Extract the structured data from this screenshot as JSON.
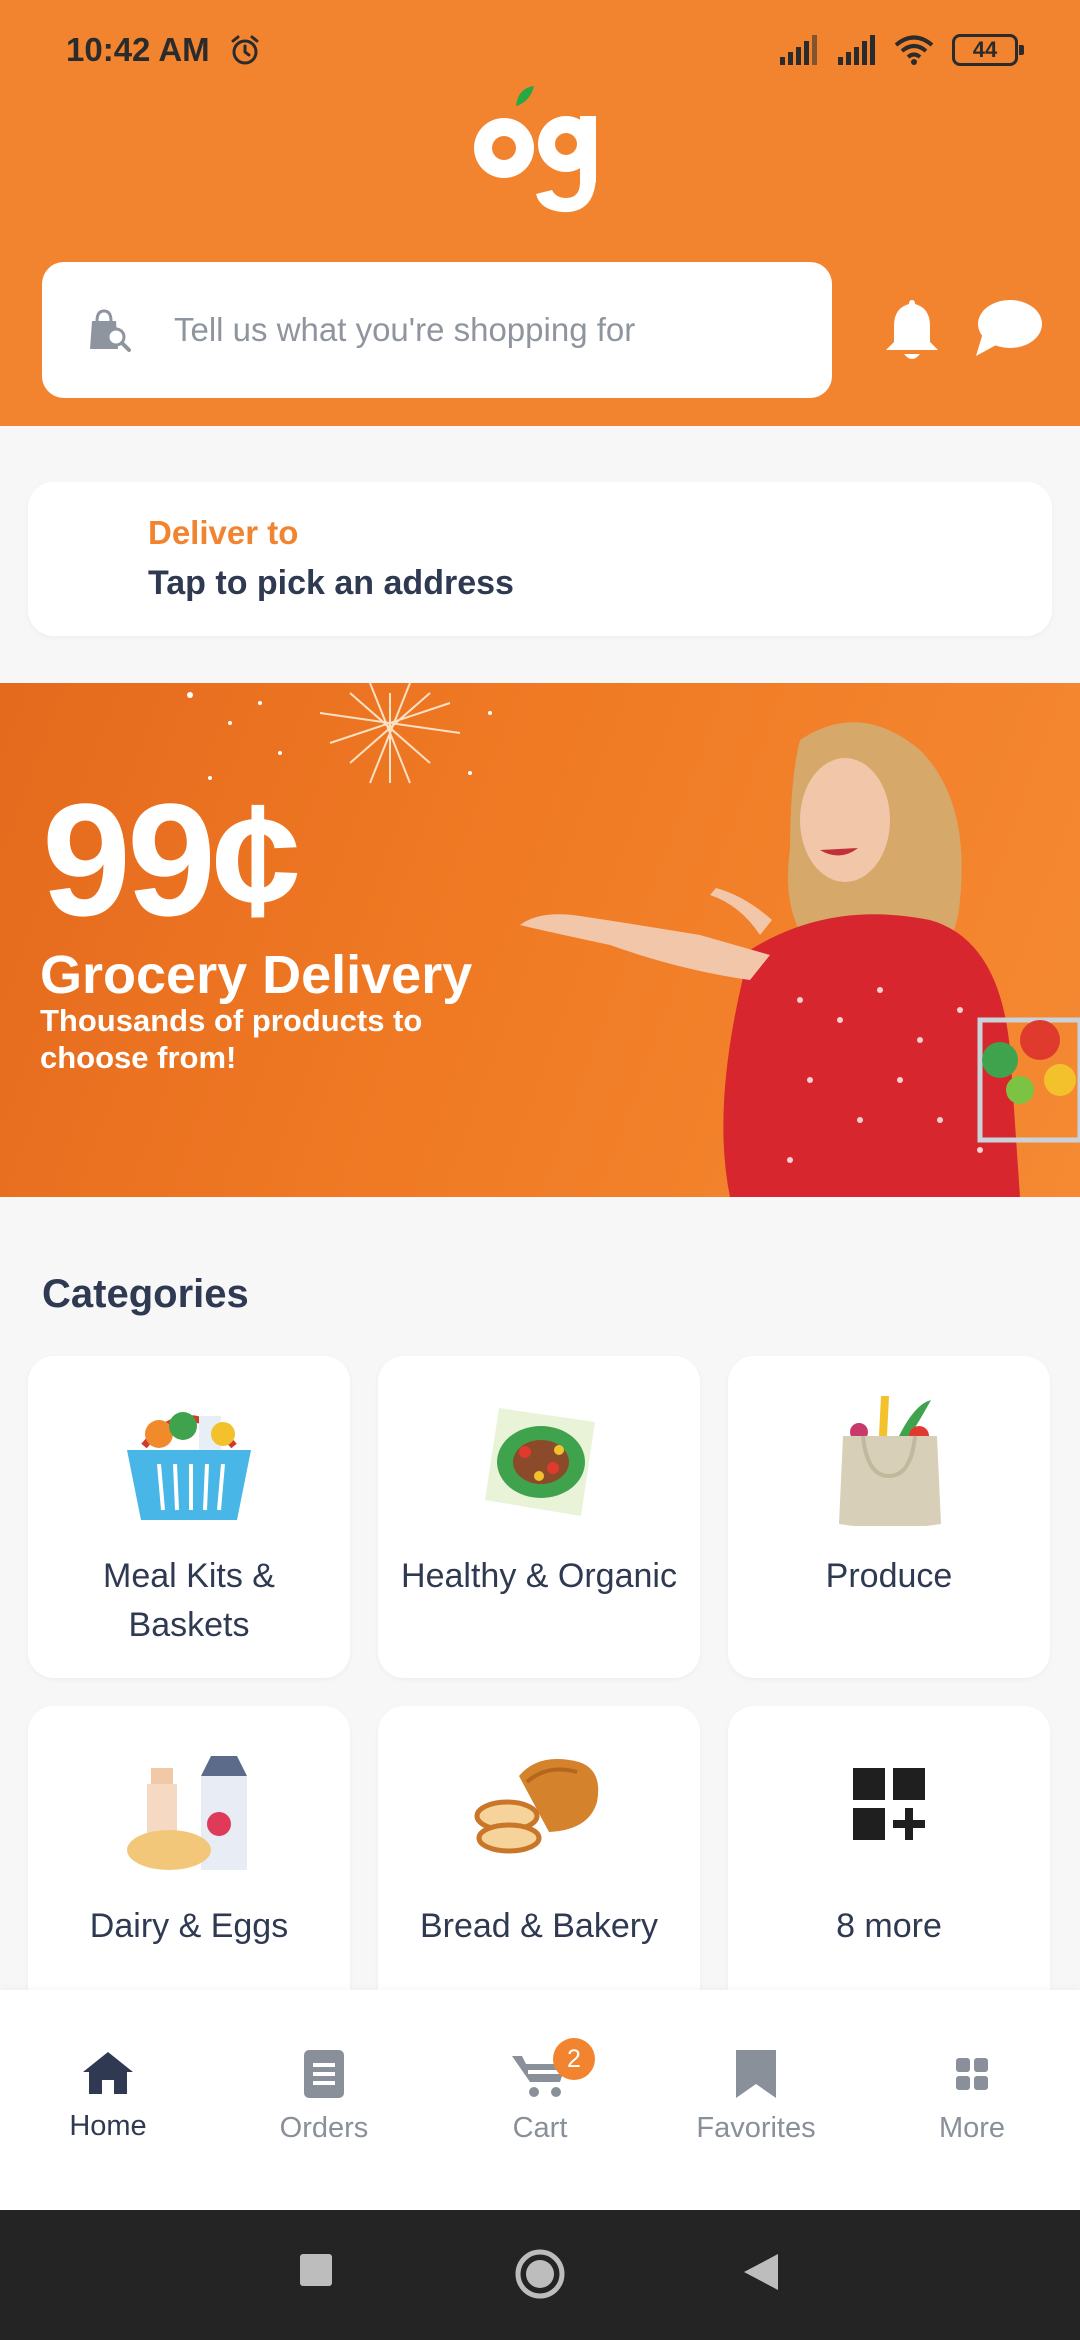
{
  "status_bar": {
    "time": "10:42 AM",
    "battery": "44",
    "icons": [
      "alarm-icon",
      "signal-icon",
      "signal-icon",
      "wifi-icon",
      "battery-icon"
    ]
  },
  "header": {
    "logo_text": "og",
    "search_placeholder": "Tell us what you're shopping for",
    "search_icon": "shopping-bag-search-icon",
    "bell_icon": "bell-icon",
    "chat_icon": "chat-bubble-icon"
  },
  "deliver": {
    "label": "Deliver to",
    "value": "Tap to pick an address",
    "icon": "location-pin-edit-icon"
  },
  "banner": {
    "price": "99¢",
    "title": "Grocery Delivery",
    "subtitle": "Thousands of products to choose from!"
  },
  "categories": {
    "heading": "Categories",
    "items": [
      {
        "label": "Meal Kits & Baskets",
        "icon": "basket-icon"
      },
      {
        "label": "Healthy & Organic",
        "icon": "salad-icon"
      },
      {
        "label": "Produce",
        "icon": "produce-bag-icon"
      },
      {
        "label": "Dairy & Eggs",
        "icon": "dairy-icon"
      },
      {
        "label": "Bread & Bakery",
        "icon": "bread-icon"
      },
      {
        "label": "8 more",
        "icon": "grid-plus-icon"
      }
    ]
  },
  "bottom_nav": {
    "items": [
      {
        "label": "Home",
        "icon": "home-icon",
        "active": true
      },
      {
        "label": "Orders",
        "icon": "orders-icon",
        "active": false
      },
      {
        "label": "Cart",
        "icon": "cart-icon",
        "active": false
      },
      {
        "label": "Favorites",
        "icon": "bookmark-icon",
        "active": false
      },
      {
        "label": "More",
        "icon": "more-grid-icon",
        "active": false
      }
    ],
    "cart_badge": "2"
  },
  "colors": {
    "brand_orange": "#f28430",
    "text_dark": "#2f3a52",
    "text_muted": "#8a9099"
  }
}
